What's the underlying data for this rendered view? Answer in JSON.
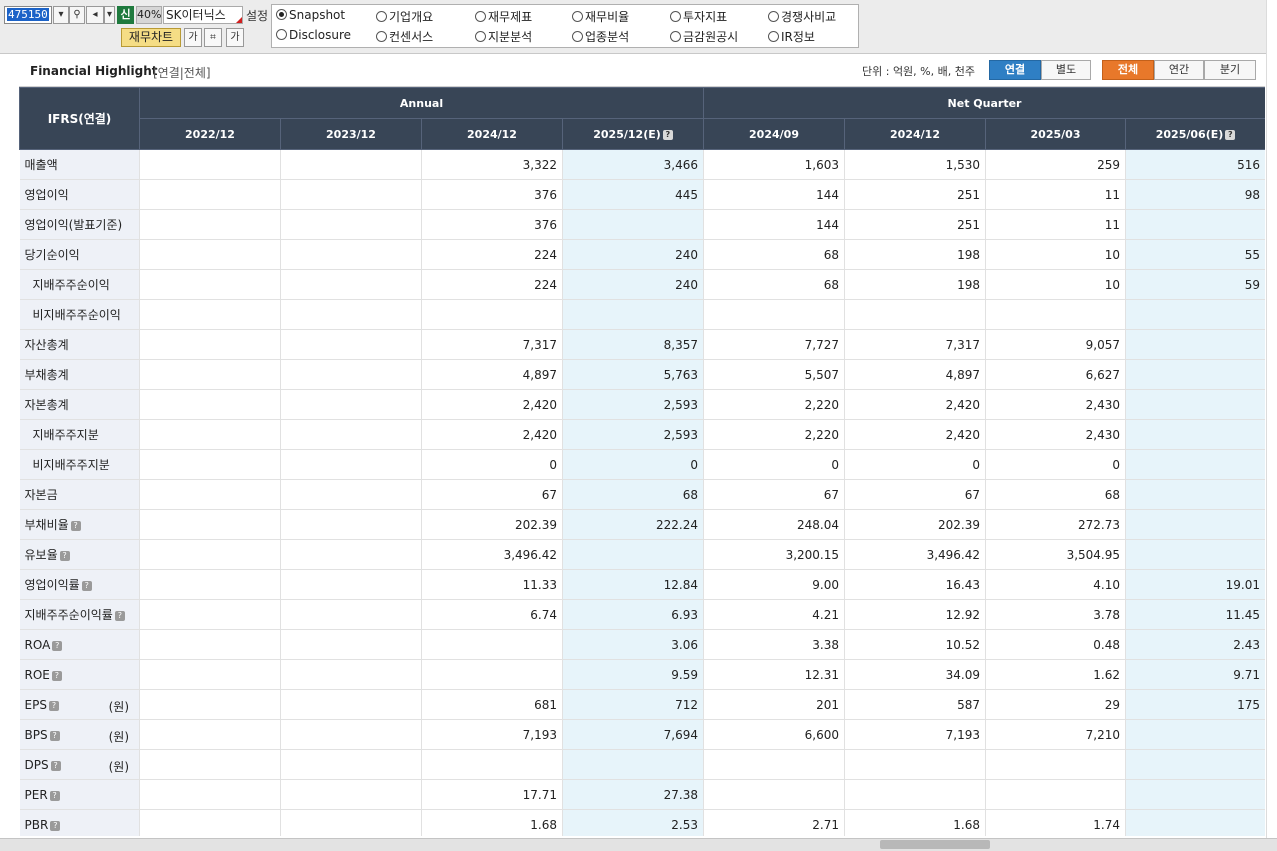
{
  "toolbar": {
    "stock_code": "475150",
    "new_label": "신",
    "pct_label": "40%",
    "stock_name": "SK이터닉스",
    "setting_label": "설정",
    "chart_label": "재무차트",
    "icon_a": "가",
    "icon_b": "가"
  },
  "menu": {
    "items": [
      {
        "label": "Snapshot",
        "selected": true
      },
      {
        "label": "기업개요",
        "selected": false
      },
      {
        "label": "재무제표",
        "selected": false
      },
      {
        "label": "재무비율",
        "selected": false
      },
      {
        "label": "투자지표",
        "selected": false
      },
      {
        "label": "경쟁사비교",
        "selected": false
      },
      {
        "label": "Disclosure",
        "selected": false
      },
      {
        "label": "컨센서스",
        "selected": false
      },
      {
        "label": "지분분석",
        "selected": false
      },
      {
        "label": "업종분석",
        "selected": false
      },
      {
        "label": "금감원공시",
        "selected": false
      },
      {
        "label": "IR정보",
        "selected": false
      }
    ]
  },
  "panel": {
    "title": "Financial Highlight",
    "subtitle": "[연결|전체]",
    "unit": "단위 : 억원, %, 배, 천주",
    "toggle_consolidated": "연결",
    "toggle_separate": "별도",
    "period_all": "전체",
    "period_annual": "연간",
    "period_quarter": "분기"
  },
  "table": {
    "corner": "IFRS(연결)",
    "group_annual": "Annual",
    "group_quarter": "Net Quarter",
    "columns": [
      "2022/12",
      "2023/12",
      "2024/12",
      "2025/12(E)",
      "2024/09",
      "2024/12",
      "2025/03",
      "2025/06(E)"
    ],
    "rows": [
      {
        "label": "매출액",
        "values": [
          "",
          "",
          "3,322",
          "3,466",
          "1,603",
          "1,530",
          "259",
          "516"
        ]
      },
      {
        "label": "영업이익",
        "values": [
          "",
          "",
          "376",
          "445",
          "144",
          "251",
          "11",
          "98"
        ]
      },
      {
        "label": "영업이익(발표기준)",
        "values": [
          "",
          "",
          "376",
          "",
          "144",
          "251",
          "11",
          ""
        ]
      },
      {
        "label": "당기순이익",
        "values": [
          "",
          "",
          "224",
          "240",
          "68",
          "198",
          "10",
          "55"
        ]
      },
      {
        "label": "지배주주순이익",
        "sub": true,
        "values": [
          "",
          "",
          "224",
          "240",
          "68",
          "198",
          "10",
          "59"
        ]
      },
      {
        "label": "비지배주주순이익",
        "sub": true,
        "values": [
          "",
          "",
          "",
          "",
          "",
          "",
          "",
          ""
        ]
      },
      {
        "label": "자산총계",
        "values": [
          "",
          "",
          "7,317",
          "8,357",
          "7,727",
          "7,317",
          "9,057",
          ""
        ]
      },
      {
        "label": "부채총계",
        "values": [
          "",
          "",
          "4,897",
          "5,763",
          "5,507",
          "4,897",
          "6,627",
          ""
        ]
      },
      {
        "label": "자본총계",
        "values": [
          "",
          "",
          "2,420",
          "2,593",
          "2,220",
          "2,420",
          "2,430",
          ""
        ]
      },
      {
        "label": "지배주주지분",
        "sub": true,
        "values": [
          "",
          "",
          "2,420",
          "2,593",
          "2,220",
          "2,420",
          "2,430",
          ""
        ]
      },
      {
        "label": "비지배주주지분",
        "sub": true,
        "values": [
          "",
          "",
          "0",
          "0",
          "0",
          "0",
          "0",
          ""
        ]
      },
      {
        "label": "자본금",
        "values": [
          "",
          "",
          "67",
          "68",
          "67",
          "67",
          "68",
          ""
        ]
      },
      {
        "label": "부채비율",
        "help": true,
        "values": [
          "",
          "",
          "202.39",
          "222.24",
          "248.04",
          "202.39",
          "272.73",
          ""
        ]
      },
      {
        "label": "유보율",
        "help": true,
        "values": [
          "",
          "",
          "3,496.42",
          "",
          "3,200.15",
          "3,496.42",
          "3,504.95",
          ""
        ]
      },
      {
        "label": "영업이익률",
        "help": true,
        "values": [
          "",
          "",
          "11.33",
          "12.84",
          "9.00",
          "16.43",
          "4.10",
          "19.01"
        ]
      },
      {
        "label": "지배주주순이익률",
        "help": true,
        "values": [
          "",
          "",
          "6.74",
          "6.93",
          "4.21",
          "12.92",
          "3.78",
          "11.45"
        ]
      },
      {
        "label": "ROA",
        "help": true,
        "values": [
          "",
          "",
          "",
          "3.06",
          "3.38",
          "10.52",
          "0.48",
          "2.43"
        ]
      },
      {
        "label": "ROE",
        "help": true,
        "values": [
          "",
          "",
          "",
          "9.59",
          "12.31",
          "34.09",
          "1.62",
          "9.71"
        ]
      },
      {
        "label": "EPS",
        "help": true,
        "unit": "(원)",
        "values": [
          "",
          "",
          "681",
          "712",
          "201",
          "587",
          "29",
          "175"
        ]
      },
      {
        "label": "BPS",
        "help": true,
        "unit": "(원)",
        "values": [
          "",
          "",
          "7,193",
          "7,694",
          "6,600",
          "7,193",
          "7,210",
          ""
        ]
      },
      {
        "label": "DPS",
        "help": true,
        "unit": "(원)",
        "values": [
          "",
          "",
          "",
          "",
          "",
          "",
          "",
          ""
        ]
      },
      {
        "label": "PER",
        "help": true,
        "values": [
          "",
          "",
          "17.71",
          "27.38",
          "",
          "",
          "",
          ""
        ]
      },
      {
        "label": "PBR",
        "help": true,
        "values": [
          "",
          "",
          "1.68",
          "2.53",
          "2.71",
          "1.68",
          "1.74",
          ""
        ]
      }
    ]
  }
}
